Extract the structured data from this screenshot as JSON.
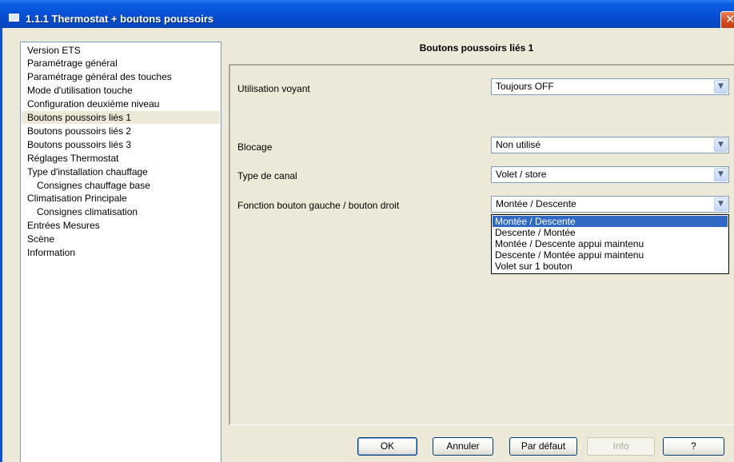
{
  "window": {
    "title": "1.1.1 Thermostat + boutons poussoirs",
    "close_glyph": "✕"
  },
  "tree": {
    "items": [
      {
        "label": "Version ETS"
      },
      {
        "label": "Paramétrage général"
      },
      {
        "label": "Paramétrage général des touches"
      },
      {
        "label": "Mode d'utilisation touche"
      },
      {
        "label": "Configuration deuxième niveau"
      },
      {
        "label": "Boutons poussoirs liés 1",
        "selected": true
      },
      {
        "label": "Boutons poussoirs liés 2"
      },
      {
        "label": "Boutons poussoirs liés 3"
      },
      {
        "label": "Réglages Thermostat"
      },
      {
        "label": "Type d'installation chauffage"
      },
      {
        "label": "Consignes chauffage base",
        "child": true
      },
      {
        "label": "Climatisation Principale"
      },
      {
        "label": "Consignes climatisation",
        "child": true
      },
      {
        "label": "Entrées Mesures"
      },
      {
        "label": "Scène"
      },
      {
        "label": "Information"
      }
    ]
  },
  "panel": {
    "heading": "Boutons poussoirs liés 1",
    "params": [
      {
        "label": "Utilisation voyant",
        "value": "Toujours OFF"
      },
      {
        "label": "Blocage",
        "value": "Non utilisé"
      },
      {
        "label": "Type de canal",
        "value": "Volet / store"
      },
      {
        "label": "Fonction bouton gauche / bouton droit",
        "value": "Montée / Descente"
      }
    ],
    "dropdown_arrow": "▼",
    "dropdown_options": [
      {
        "label": "Montée / Descente",
        "highlighted": true
      },
      {
        "label": "Descente / Montée"
      },
      {
        "label": "Montée / Descente appui maintenu"
      },
      {
        "label": "Descente / Montée appui maintenu"
      },
      {
        "label": "Volet sur 1 bouton"
      }
    ]
  },
  "buttons": {
    "ok": "OK",
    "cancel": "Annuler",
    "default": "Par défaut",
    "info": "Info",
    "help": "?"
  },
  "colors": {
    "titlebar": "#0651d6",
    "selection": "#316ac5",
    "dialog_bg": "#ece9d8"
  }
}
